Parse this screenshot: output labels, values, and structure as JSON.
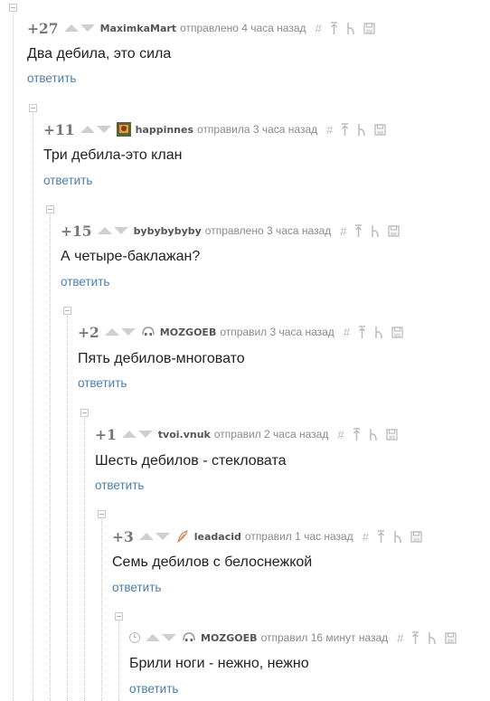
{
  "reply_label": "ответить",
  "comments": [
    {
      "rating": "+27",
      "author": "MaximkaMart",
      "posted": "отправлено 4 часа назад",
      "text": "Два дебила, это сила",
      "avatar": "none"
    },
    {
      "rating": "+11",
      "author": "happinnes",
      "posted": "отправила 3 часа назад",
      "text": "Три дебила-это клан",
      "avatar": "photo-avatar"
    },
    {
      "rating": "+15",
      "author": "bybybybyby",
      "posted": "отправлено 3 часа назад",
      "text": "А четыре-баклажан?",
      "avatar": "none"
    },
    {
      "rating": "+2",
      "author": "MOZGOEB",
      "posted": "отправил 3 часа назад",
      "text": "Пять дебилов-многовато",
      "avatar": "mask-avatar"
    },
    {
      "rating": "+1",
      "author": "tvoi.vnuk",
      "posted": "отправил 2 часа назад",
      "text": "Шесть дебилов - стекловата",
      "avatar": "none"
    },
    {
      "rating": "+3",
      "author": "leadacid",
      "posted": "отправил 1 час назад",
      "text": "Семь дебилов с белоснежкой",
      "avatar": "feather-avatar"
    },
    {
      "rating": "",
      "author": "MOZGOEB",
      "posted": "отправил 16 минут назад",
      "text": "Брили ноги - нежно, нежно",
      "avatar": "mask-avatar",
      "pending_icon": "clock-icon"
    }
  ],
  "tool_icons": [
    "hash-icon",
    "pin-up-icon",
    "branch-icon",
    "save-icon"
  ]
}
